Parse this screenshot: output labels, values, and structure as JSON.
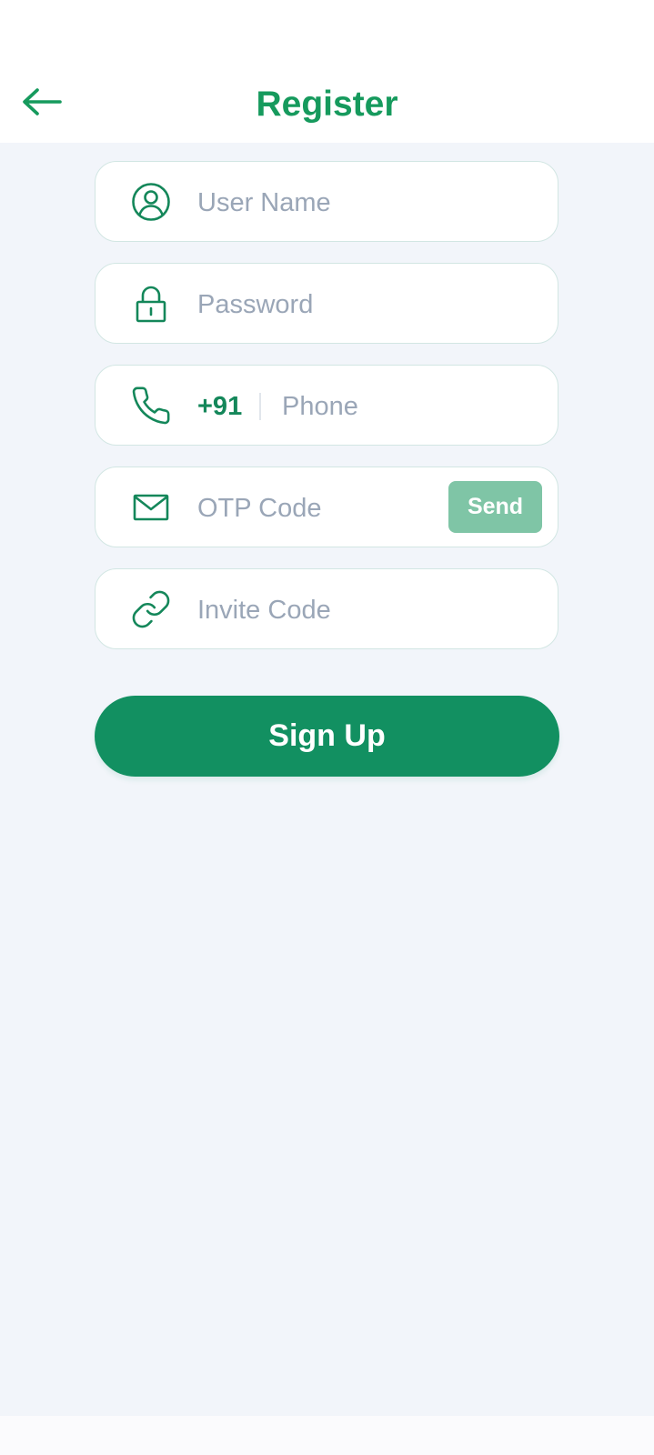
{
  "header": {
    "title": "Register",
    "back_icon": "arrow-left-icon"
  },
  "form": {
    "username": {
      "placeholder": "User Name",
      "value": "",
      "icon": "user-circle-icon"
    },
    "password": {
      "placeholder": "Password",
      "value": "",
      "icon": "lock-icon"
    },
    "phone": {
      "country_code": "+91",
      "placeholder": "Phone",
      "value": "",
      "icon": "phone-icon"
    },
    "otp": {
      "placeholder": "OTP Code",
      "value": "",
      "icon": "mail-icon",
      "send_label": "Send"
    },
    "invite": {
      "placeholder": "Invite Code",
      "value": "",
      "icon": "link-icon"
    }
  },
  "actions": {
    "signup_label": "Sign Up"
  },
  "colors": {
    "accent": "#169a5d",
    "button": "#129061",
    "send_button": "#7fc5a6",
    "background": "#f2f5fa",
    "field_border": "#d2e6e3",
    "placeholder": "#9aa6b7"
  }
}
